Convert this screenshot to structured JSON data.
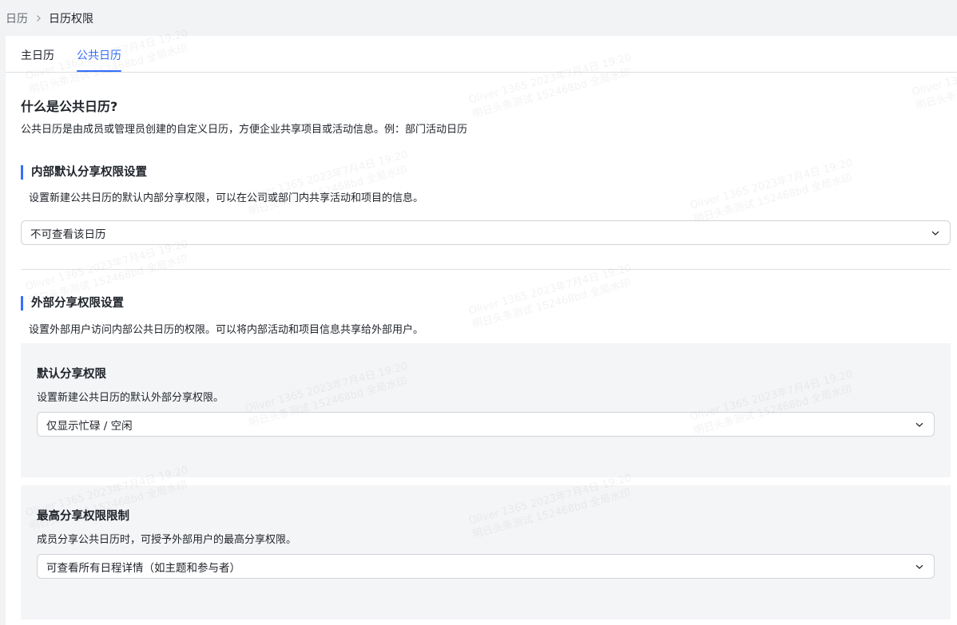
{
  "breadcrumb": {
    "parent": "日历",
    "current": "日历权限"
  },
  "tabs": [
    {
      "label": "主日历",
      "active": false
    },
    {
      "label": "公共日历",
      "active": true
    }
  ],
  "intro": {
    "title": "什么是公共日历?",
    "description": "公共日历是由成员或管理员创建的自定义日历，方便企业共享项目或活动信息。例：部门活动日历"
  },
  "internal": {
    "title": "内部默认分享权限设置",
    "description": "设置新建公共日历的默认内部分享权限，可以在公司或部门内共享活动和项目的信息。",
    "selected": "不可查看该日历"
  },
  "external": {
    "title": "外部分享权限设置",
    "description": "设置外部用户访问内部公共日历的权限。可以将内部活动和项目信息共享给外部用户。",
    "default_share": {
      "title": "默认分享权限",
      "description": "设置新建公共日历的默认外部分享权限。",
      "selected": "仅显示忙碌 / 空闲"
    },
    "max_share": {
      "title": "最高分享权限限制",
      "description": "成员分享公共日历时，可授予外部用户的最高分享权限。",
      "selected": "可查看所有日程详情（如主题和参与者）"
    }
  },
  "watermark": {
    "line1": "Oliver 1365 2023年7月4日 19:20",
    "line2": "明日头条测试 152468bd 全局水印"
  },
  "colors": {
    "accent": "#3370ff",
    "page_bg": "#f2f3f5",
    "panel_bg": "#f4f5f7",
    "border": "#d0d3d6"
  },
  "icons": {
    "breadcrumb_separator": "chevron-right-icon",
    "select_arrow": "chevron-down-icon"
  }
}
